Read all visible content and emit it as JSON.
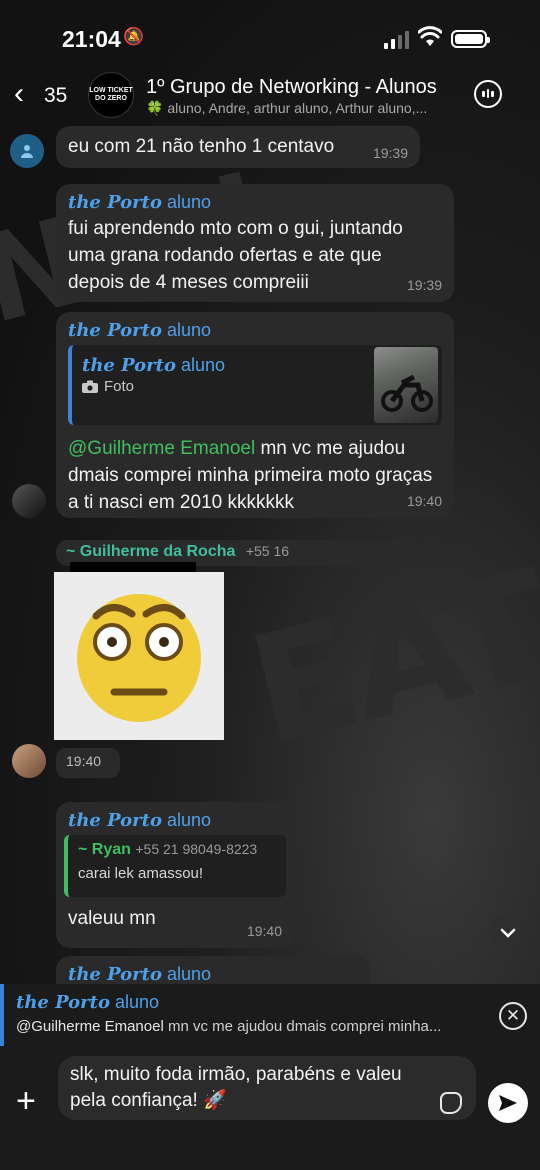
{
  "status_bar": {
    "time": "21:04"
  },
  "header": {
    "back_count": "35",
    "avatar_text": "LOW TICKET DO ZERO",
    "title": "1º Grupo de Networking - Alunos",
    "members": "🍀 aluno, Andre, arthur aluno, Arthur aluno,..."
  },
  "messages": [
    {
      "text": "eu com 21 não tenho 1 centavo",
      "time": "19:39"
    },
    {
      "sender_prefix": "the Porto",
      "sender_suffix": " aluno",
      "text": "fui aprendendo mto com o gui, juntando uma grana rodando ofertas e ate que depois de 4 meses compreiii",
      "time": "19:39"
    },
    {
      "sender_prefix": "the Porto",
      "sender_suffix": " aluno",
      "quote_prefix": "the Porto",
      "quote_suffix": " aluno",
      "quote_type": "Foto",
      "mention": "@Guilherme Emanoel",
      "text": " mn vc me ajudou dmais comprei minha primeira moto graças a ti nasci em 2010 kkkkkkk",
      "time": "19:40"
    },
    {
      "sender": "~ Guilherme da Rocha",
      "phone": "+55 16",
      "time": "19:40"
    },
    {
      "sender_prefix": "the Porto",
      "sender_suffix": " aluno",
      "quote_sender": "~ Ryan",
      "quote_phone": "+55 21 98049-8223",
      "quote_text": "carai lek amassou!",
      "text": "valeuu mn",
      "time": "19:40"
    },
    {
      "sender_prefix": "the Porto",
      "sender_suffix": " aluno"
    }
  ],
  "reply": {
    "name_prefix": "the Porto",
    "name_suffix": " aluno",
    "mention": "@Guilherme Emanoel",
    "text": " mn vc me ajudou dmais comprei minha..."
  },
  "composer": {
    "value": "slk, muito foda irmão, parabéns e valeu pela confiança! 🚀"
  },
  "colors": {
    "accent": "#4ea0ea",
    "mention": "#3fbf5f",
    "bubble": "#2a2a2a"
  }
}
